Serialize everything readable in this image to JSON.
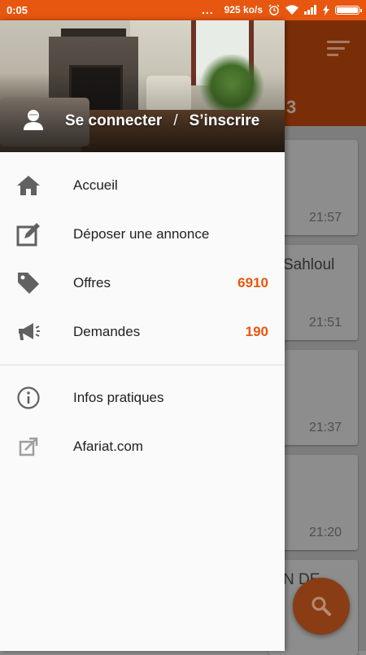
{
  "status_bar": {
    "time": "0:05",
    "dots": "...",
    "speed": "925 ko/s",
    "battery_level": 1.0
  },
  "background": {
    "count_partial": "3",
    "cards": [
      {
        "title": "",
        "time": "21:57"
      },
      {
        "title": "Sahloul",
        "time": "21:51"
      },
      {
        "title": "",
        "time": "21:37"
      },
      {
        "title": "",
        "time": "21:20"
      },
      {
        "title": "N DE",
        "time": ""
      }
    ]
  },
  "drawer": {
    "header": {
      "login": "Se connecter",
      "separator": "/",
      "register": "S’inscrire"
    },
    "items": [
      {
        "label": "Accueil",
        "badge": "",
        "icon": "home-icon"
      },
      {
        "label": "Déposer une annonce",
        "badge": "",
        "icon": "edit-icon"
      },
      {
        "label": "Offres",
        "badge": "6910",
        "icon": "tag-icon"
      },
      {
        "label": "Demandes",
        "badge": "190",
        "icon": "megaphone-icon"
      }
    ],
    "secondary_items": [
      {
        "label": "Infos pratiques",
        "icon": "info-icon"
      },
      {
        "label": "Afariat.com",
        "icon": "external-link-icon"
      }
    ]
  },
  "colors": {
    "accent": "#e8570f",
    "status_bar": "#e8570f",
    "icon": "#616161"
  }
}
